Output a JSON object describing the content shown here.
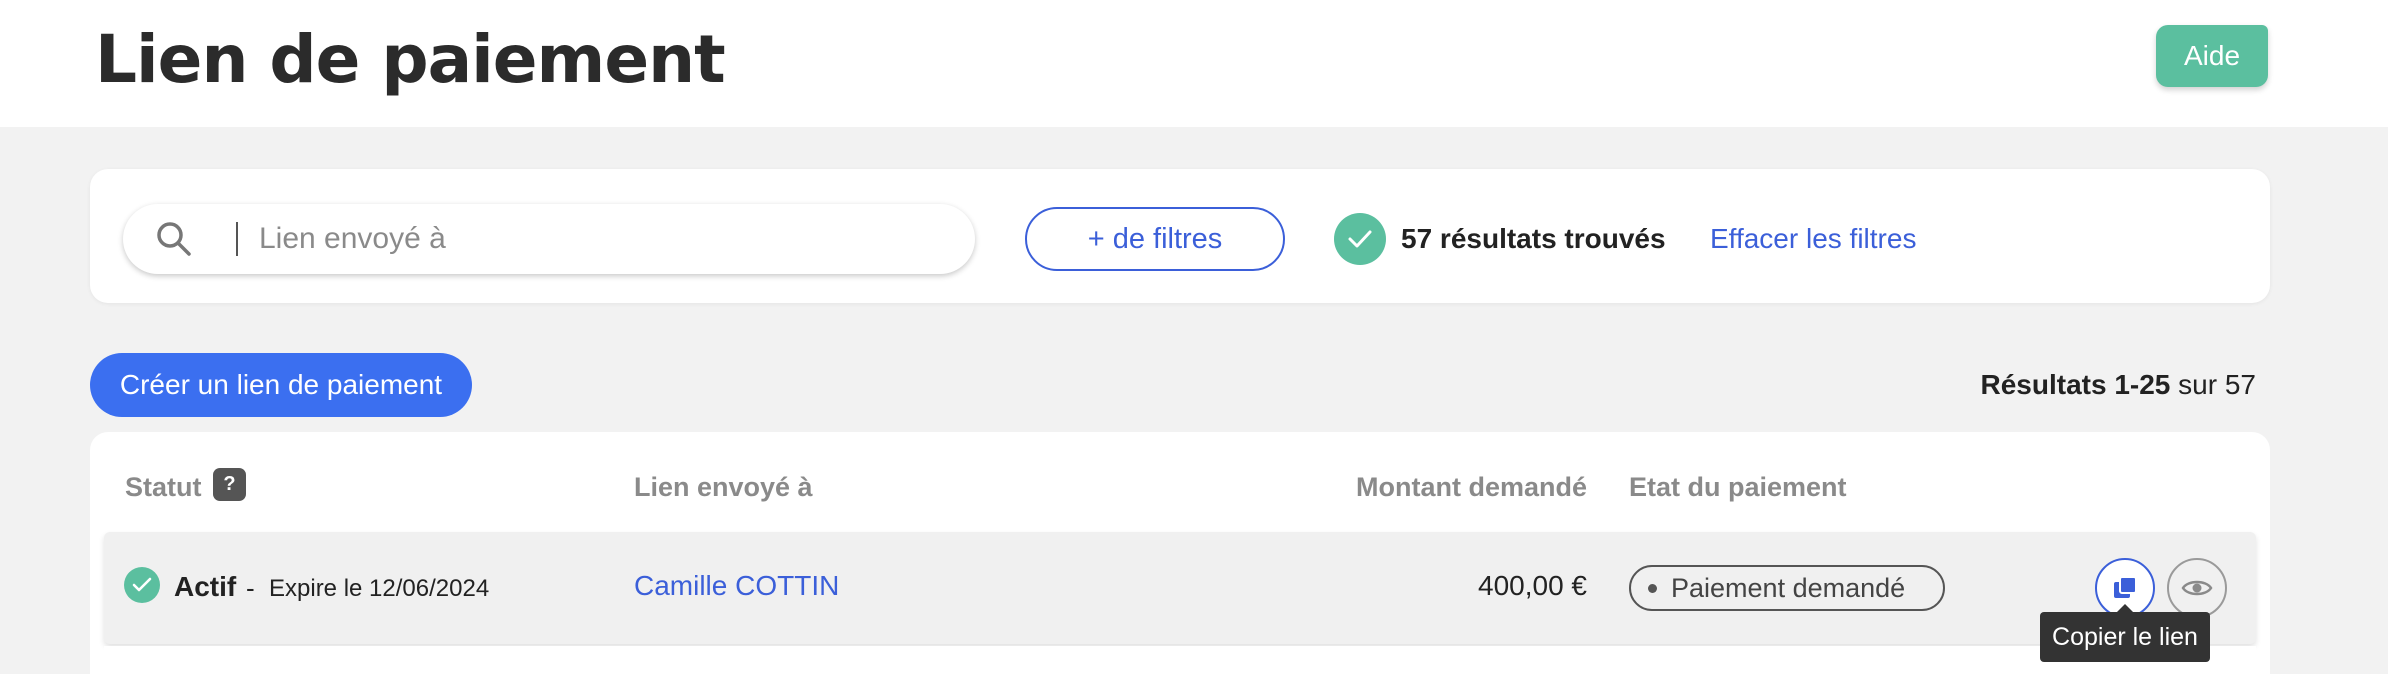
{
  "header": {
    "title": "Lien de paiement",
    "help_label": "Aide",
    "help_color": "#5bbf9f"
  },
  "filters": {
    "search_placeholder": "Lien envoyé à",
    "search_value": "",
    "more_filters_label": "+ de filtres",
    "results_found": "57 résultats trouvés",
    "clear_filters_label": "Effacer les filtres"
  },
  "actions": {
    "create_label": "Créer un lien de paiement"
  },
  "pagination": {
    "prefix": "Résultats 1-25",
    "suffix": " sur 57"
  },
  "table": {
    "columns": {
      "status": "Statut",
      "status_help": "?",
      "recipient": "Lien envoyé à",
      "amount": "Montant demandé",
      "payment_state": "Etat du paiement"
    },
    "rows": [
      {
        "status": "Actif",
        "separator": "-",
        "expiry": "Expire le 12/06/2024",
        "recipient": "Camille COTTIN",
        "amount": "400,00 €",
        "payment_state": "Paiement demandé",
        "icons": [
          "check-icon",
          "copy-icon",
          "eye-icon"
        ]
      }
    ]
  },
  "tooltip": {
    "text": "Copier le lien"
  },
  "colors": {
    "primary": "#3b6ff0",
    "link": "#3b5fd9",
    "success": "#5bbf9f"
  }
}
